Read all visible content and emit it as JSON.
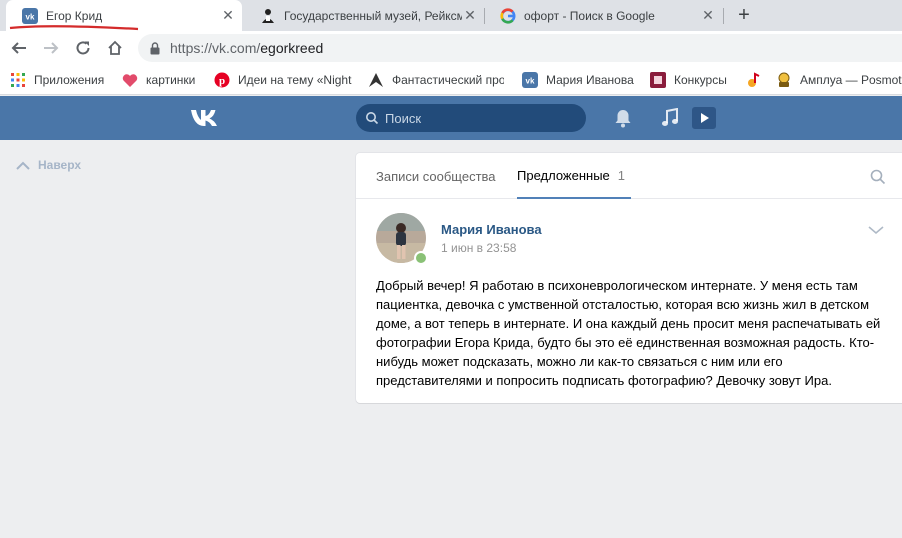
{
  "browser": {
    "tabs": [
      {
        "title": "Егор Крид",
        "favicon": "vk-icon",
        "active": true
      },
      {
        "title": "Государственный музей, Рейксм",
        "favicon": "museum-icon",
        "active": false
      },
      {
        "title": "офорт - Поиск в Google",
        "favicon": "google-icon",
        "active": false
      }
    ],
    "new_tab_label": "+",
    "url_host": "https://vk.com/",
    "url_path": "egorkreed",
    "bookmarks": [
      {
        "label": "Приложения",
        "icon": "apps-grid-icon"
      },
      {
        "label": "картинки",
        "icon": "heart-icon"
      },
      {
        "label": "Идеи на тему «Night",
        "icon": "pinterest-icon"
      },
      {
        "label": "Фантастический про",
        "icon": "fantasy-icon"
      },
      {
        "label": "Мария Иванова",
        "icon": "vk-icon"
      },
      {
        "label": "Конкурсы",
        "icon": "contest-icon"
      },
      {
        "label": "",
        "icon": "music-note-icon"
      },
      {
        "label": "Амплуа — Posmot",
        "icon": "amplua-icon"
      }
    ]
  },
  "vk": {
    "search_placeholder": "Поиск",
    "colors": {
      "header": "#4a76a8",
      "search_bg": "#224b7a",
      "link": "#2a5885",
      "page_bg": "#edeef0"
    }
  },
  "left": {
    "back_up_label": "Наверх"
  },
  "wall": {
    "tabs": [
      {
        "label": "Записи сообщества",
        "count": ""
      },
      {
        "label": "Предложенные",
        "count": "1"
      }
    ],
    "post": {
      "author": "Мария Иванова",
      "date": "1 июн в 23:58",
      "text": "Добрый вечер! Я работаю в психоневрологическом интернате. У меня есть там пациентка, девочка с умственной отсталостью, которая всю жизнь жил в детском доме, а вот теперь в интернате. И она каждый день просит меня распечатывать ей фотографии Егора Крида, будто бы это её единственная возможная радость. Кто-нибудь может подсказать, можно ли как-то связаться с ним или его представителями и попросить подписать фотографию? Девочку зовут Ира."
    }
  }
}
